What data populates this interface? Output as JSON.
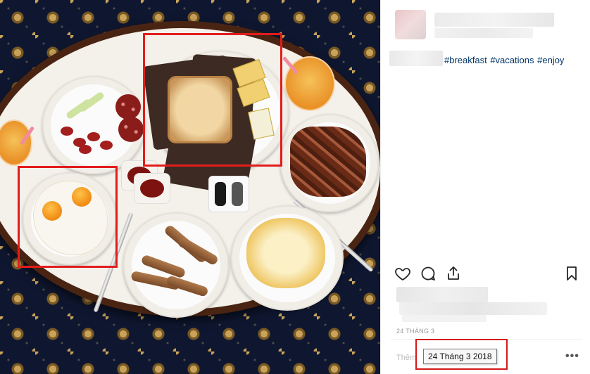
{
  "post": {
    "hashtags": [
      "#breakfast",
      "#vacations",
      "#enjoy"
    ]
  },
  "actions": {
    "like_icon": "heart-icon",
    "comment_icon": "comment-bubble-icon",
    "share_icon": "share-icon",
    "save_icon": "bookmark-icon"
  },
  "meta": {
    "date_small": "24 THÁNG 3",
    "date_tooltip": "24 Tháng 3 2018",
    "add_comment_placeholder": "Thêm",
    "more_options": "•••"
  },
  "annotations": {
    "highlight_color": "#e21c1c"
  }
}
